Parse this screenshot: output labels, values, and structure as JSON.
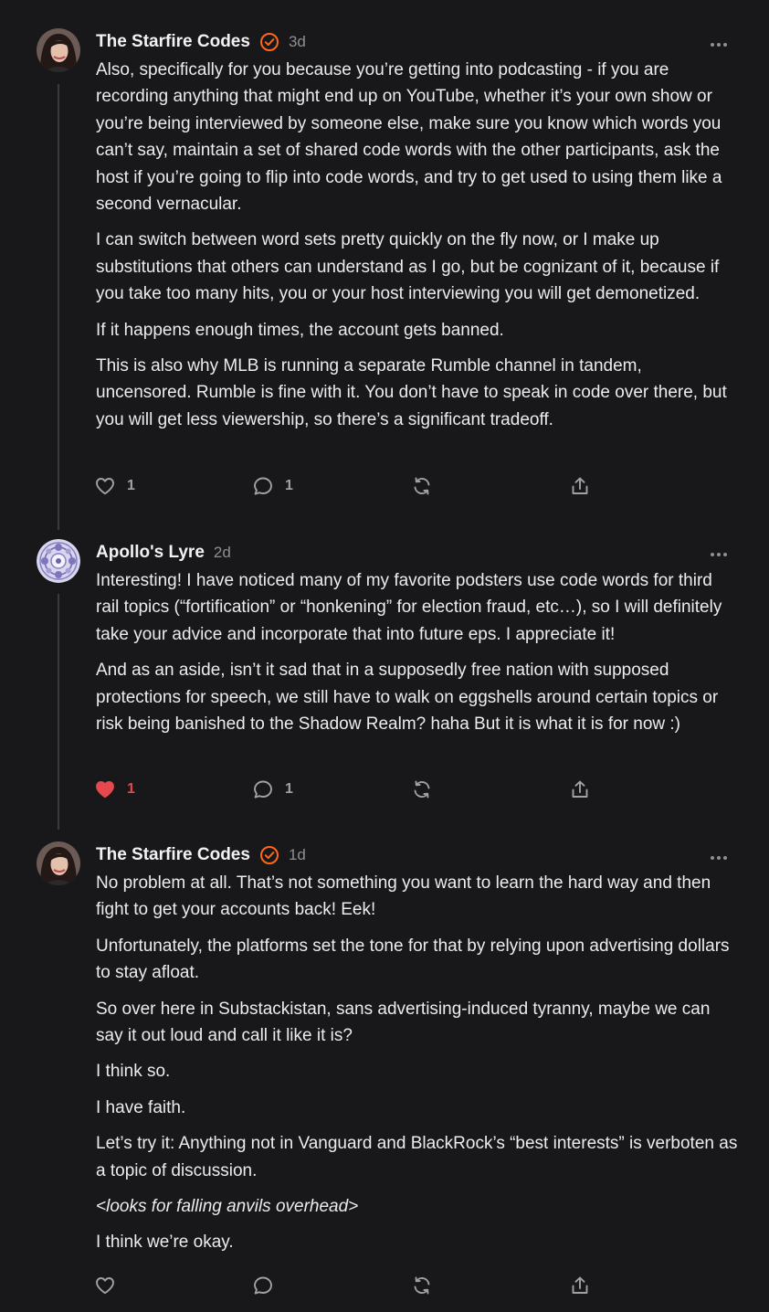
{
  "comments": [
    {
      "author": "The Starfire Codes",
      "verified": true,
      "timestamp": "3d",
      "paragraphs": [
        "Also, specifically for you because you’re getting into podcasting - if you are recording anything that might end up on YouTube, whether it’s your own show or you’re being interviewed by someone else, make sure you know which words you can’t say, maintain a set of shared code words with the other participants, ask the host if you’re going to flip into code words, and try to get used to using them like a second vernacular.",
        "I can switch between word sets pretty quickly on the fly now, or I make up substitutions that others can understand as I go, but be cognizant of it, because if you take too many hits, you or your host interviewing you will get demonetized.",
        "If it happens enough times, the account gets banned.",
        "This is also why MLB is running a separate Rumble channel in tandem, uncensored. Rumble is fine with it. You don’t have to speak in code over there, but you will get less viewership, so there’s a significant tradeoff."
      ],
      "likes": "1",
      "liked": false,
      "replies": "1"
    },
    {
      "author": "Apollo's Lyre",
      "verified": false,
      "timestamp": "2d",
      "paragraphs": [
        "Interesting! I have noticed many of my favorite podsters use code words for third rail topics (“fortification” or “honkening” for election fraud, etc…), so I will definitely take your advice and incorporate that into future eps. I appreciate it!",
        "And as an aside, isn’t it sad that in a supposedly free nation with supposed protections for speech, we still have to walk on eggshells around certain topics or risk being banished to the Shadow Realm? haha But it is what it is for now :)"
      ],
      "likes": "1",
      "liked": true,
      "replies": "1"
    },
    {
      "author": "The Starfire Codes",
      "verified": true,
      "timestamp": "1d",
      "paragraphs": [
        "No problem at all. That’s not something you want to learn the hard way and then fight to get your accounts back! Eek!",
        "Unfortunately, the platforms set the tone for that by relying upon advertising dollars to stay afloat.",
        "So over here in Substackistan, sans advertising-induced tyranny, maybe we can say it out loud and call it like it is?",
        "I think so.",
        "I have faith.",
        "Let’s try it: Anything not in Vanguard and BlackRock’s “best interests” is verboten as a topic of discussion.",
        "<looks for falling anvils overhead>",
        "I think we’re okay."
      ],
      "italic_paragraph_index": 6,
      "likes": "",
      "liked": false,
      "replies": ""
    }
  ],
  "icons": {
    "like": "heart-icon",
    "reply": "speech-bubble-icon",
    "restack": "restack-arrows-icon",
    "share": "share-upload-icon",
    "more": "more-horizontal-icon",
    "verified": "verified-check-icon"
  },
  "colors": {
    "background": "#18181b",
    "text": "#ececec",
    "muted": "#8e8e93",
    "accent": "#ff6719",
    "liked": "#e5484d",
    "thread_line": "#3a3a3e"
  }
}
